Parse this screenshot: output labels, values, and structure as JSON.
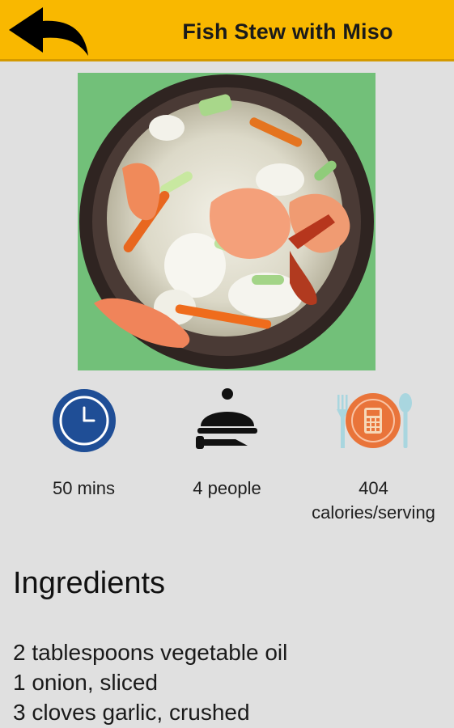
{
  "header": {
    "title": "Fish Stew with Miso",
    "back_icon": "curved-back-arrow-icon",
    "background": "#f9b800"
  },
  "hero_image": {
    "description_icon": "fish-stew-photo"
  },
  "stats": {
    "time": {
      "icon": "clock-icon",
      "label": "50 mins",
      "color": "#1f4e96"
    },
    "servings": {
      "icon": "serving-cloche-icon",
      "label": "4 people",
      "color": "#111111"
    },
    "calories": {
      "icon": "calorie-calculator-plate-icon",
      "value": "404",
      "unit": "calories/serving",
      "color": "#e9743a"
    }
  },
  "ingredients": {
    "heading": "Ingredients",
    "items": [
      "2 tablespoons vegetable oil",
      "1 onion, sliced",
      "3 cloves garlic, crushed"
    ]
  }
}
